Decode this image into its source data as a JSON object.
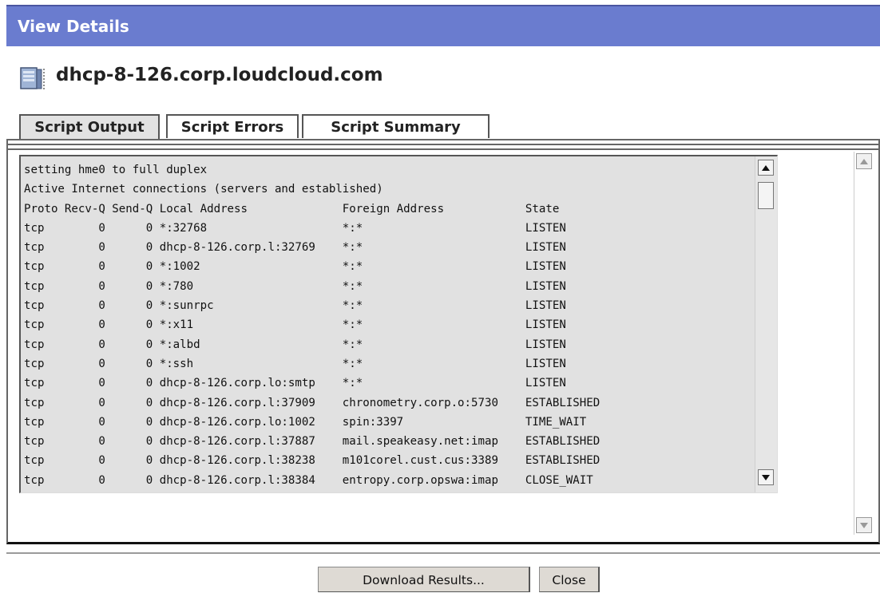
{
  "window": {
    "title": "View Details"
  },
  "header": {
    "hostname": "dhcp-8-126.corp.loudcloud.com",
    "icon": "server-icon"
  },
  "tabs": [
    {
      "label": "Script Output",
      "active": true
    },
    {
      "label": "Script Errors",
      "active": false
    },
    {
      "label": "Script Summary",
      "active": false
    }
  ],
  "output": {
    "lines": [
      "setting hme0 to full duplex",
      "Active Internet connections (servers and established)",
      "Proto Recv-Q Send-Q Local Address              Foreign Address            State",
      "tcp        0      0 *:32768                    *:*                        LISTEN",
      "tcp        0      0 dhcp-8-126.corp.l:32769    *:*                        LISTEN",
      "tcp        0      0 *:1002                     *:*                        LISTEN",
      "tcp        0      0 *:780                      *:*                        LISTEN",
      "tcp        0      0 *:sunrpc                   *:*                        LISTEN",
      "tcp        0      0 *:x11                      *:*                        LISTEN",
      "tcp        0      0 *:albd                     *:*                        LISTEN",
      "tcp        0      0 *:ssh                      *:*                        LISTEN",
      "tcp        0      0 dhcp-8-126.corp.lo:smtp    *:*                        LISTEN",
      "tcp        0      0 dhcp-8-126.corp.l:37909    chronometry.corp.o:5730    ESTABLISHED",
      "tcp        0      0 dhcp-8-126.corp.lo:1002    spin:3397                  TIME_WAIT",
      "tcp        0      0 dhcp-8-126.corp.l:37887    mail.speakeasy.net:imap    ESTABLISHED",
      "tcp        0      0 dhcp-8-126.corp.l:38238    m101corel.cust.cus:3389    ESTABLISHED",
      "tcp        0      0 dhcp-8-126.corp.l:38384    entropy.corp.opswa:imap    CLOSE_WAIT"
    ]
  },
  "buttons": {
    "download": "Download Results...",
    "close": "Close"
  }
}
